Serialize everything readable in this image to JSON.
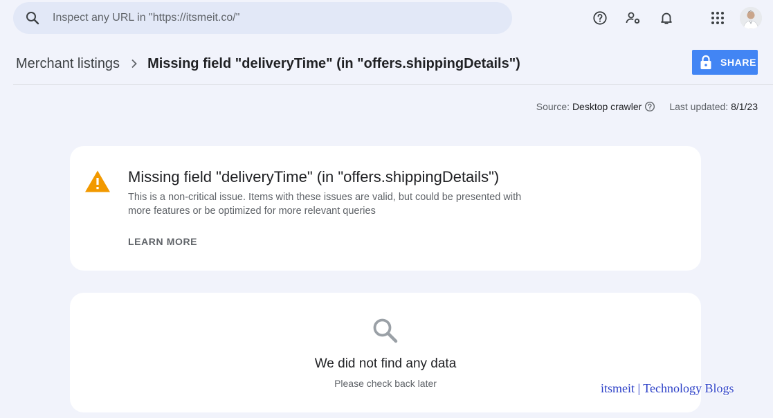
{
  "search": {
    "placeholder": "Inspect any URL in \"https://itsmeit.co/\""
  },
  "topbar": {
    "icons": [
      "help-circle-icon",
      "manage-users-icon",
      "notifications-bell-icon",
      "apps-grid-icon"
    ]
  },
  "breadcrumb": {
    "parent": "Merchant listings",
    "current": "Missing field \"deliveryTime\" (in \"offers.shippingDetails\")"
  },
  "share": {
    "label": "SHARE"
  },
  "meta": {
    "source_label": "Source:",
    "source_value": "Desktop crawler",
    "updated_label": "Last updated:",
    "updated_value": "8/1/23"
  },
  "issue": {
    "title": "Missing field \"deliveryTime\" (in \"offers.shippingDetails\")",
    "description": "This is a non-critical issue. Items with these issues are valid, but could be presented with more features or be optimized for more relevant queries",
    "learn_more": "LEARN MORE",
    "severity_color": "#f29900"
  },
  "empty": {
    "title": "We did not find any data",
    "subtitle": "Please check back later"
  },
  "watermark": "itsmeit | Technology Blogs",
  "colors": {
    "accent": "#4285f4",
    "background": "#f1f3fb",
    "search_bg": "#e2e8f7"
  }
}
